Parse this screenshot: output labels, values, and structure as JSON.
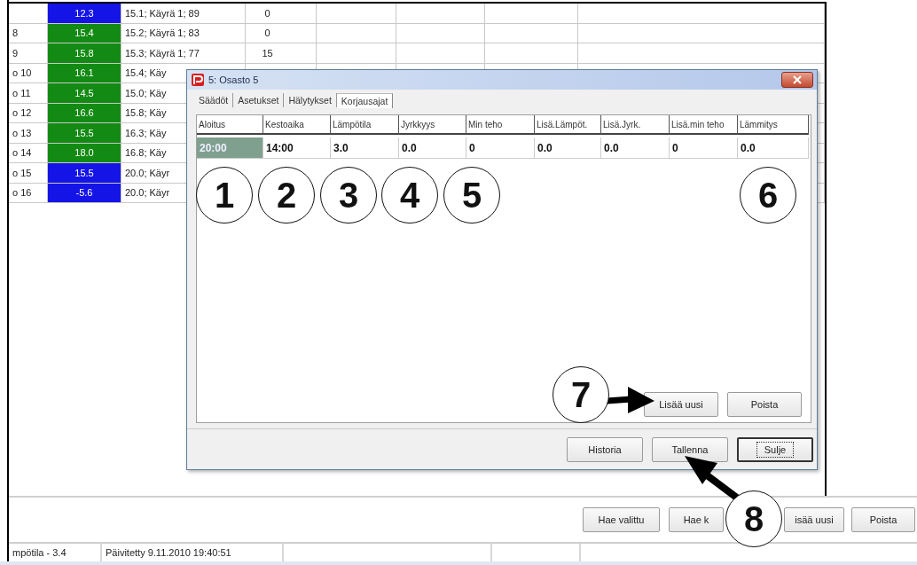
{
  "table": {
    "rows": [
      {
        "label": "",
        "value": "12.3",
        "color": "#1414e6",
        "curve": "15.1; Käyrä 1; 89",
        "column_4": "0"
      },
      {
        "label": "8",
        "value": "15.4",
        "color": "#138a13",
        "curve": "15.2; Käyrä 1; 83",
        "column_4": "0"
      },
      {
        "label": "9",
        "value": "15.8",
        "color": "#138a13",
        "curve": "15.3; Käyrä 1; 77",
        "column_4": "15"
      },
      {
        "label": "o 10",
        "value": "16.1",
        "color": "#138a13",
        "curve": "15.4; Käy"
      },
      {
        "label": "o 11",
        "value": "14.5",
        "color": "#138a13",
        "curve": "15.0; Käy"
      },
      {
        "label": "o 12",
        "value": "16.6",
        "color": "#138a13",
        "curve": "15.8; Käy"
      },
      {
        "label": "o 13",
        "value": "15.5",
        "color": "#138a13",
        "curve": "16.3; Käy"
      },
      {
        "label": "o 14",
        "value": "18.0",
        "color": "#138a13",
        "curve": "16.8; Käy"
      },
      {
        "label": "o 15",
        "value": "15.5",
        "color": "#1414e6",
        "curve": "20.0; Käyr"
      },
      {
        "label": "o 16",
        "value": "-5.6",
        "color": "#1414e6",
        "curve": "20.0; Käyr"
      }
    ]
  },
  "dialog": {
    "title": "5: Osasto 5",
    "tabs": [
      {
        "label": "Säädöt",
        "selected": false
      },
      {
        "label": "Asetukset",
        "selected": false
      },
      {
        "label": "Hälytykset",
        "selected": false
      },
      {
        "label": "Korjausajat",
        "selected": true
      }
    ],
    "grid": {
      "columns": [
        "Aloitus",
        "Kestoaika",
        "Lämpötila",
        "Jyrkkyys",
        "Min teho",
        "Lisä.Lämpöt.",
        "Lisä.Jyrk.",
        "Lisä.min teho",
        "Lämmitys"
      ],
      "rows": [
        {
          "cells": [
            {
              "text": "20:00",
              "selected": true
            },
            {
              "text": "14:00",
              "selected": false
            },
            {
              "text": "3.0",
              "selected": false
            },
            {
              "text": "0.0",
              "selected": false
            },
            {
              "text": "0",
              "selected": false
            },
            {
              "text": "0.0",
              "selected": false
            },
            {
              "text": "0.0",
              "selected": false
            },
            {
              "text": "0",
              "selected": false
            },
            {
              "text": "0.0",
              "selected": false
            }
          ]
        }
      ]
    },
    "grid_buttons": [
      "Lisää uusi",
      "Poista"
    ],
    "footer_buttons": [
      {
        "label": "Historia",
        "focused": false
      },
      {
        "label": "Tallenna",
        "focused": false
      },
      {
        "label": "Sulje",
        "focused": true
      }
    ]
  },
  "bottom_buttons": [
    "Hae valittu",
    "Hae k",
    "isää uusi",
    "Poista"
  ],
  "status_bar": [
    "mpötila - 3.4",
    "Päivitetty 9.11.2010 19:40:51"
  ],
  "callouts": [
    "1",
    "2",
    "3",
    "4",
    "5",
    "6",
    "7",
    "8"
  ]
}
